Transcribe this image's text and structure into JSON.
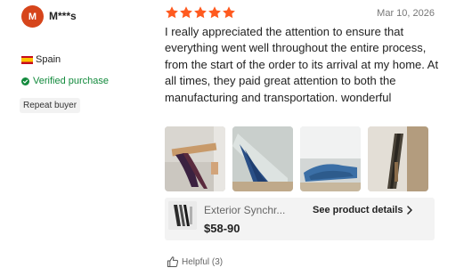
{
  "reviewer": {
    "avatar_letter": "M",
    "name": "M***s",
    "country": "Spain",
    "flag_icon": "spain-flag-icon",
    "verified_label": "Verified purchase",
    "verified_color": "#128a3c",
    "badge": "Repeat buyer"
  },
  "review": {
    "rating": 5,
    "max_rating": 5,
    "star_color": "#ff5a1f",
    "date": "Mar 10, 2026",
    "text": "I really appreciated the attention to ensure that everything went well throughout the entire process, from the start of the order to its arrival at my home. At all times, they paid great attention to both the manufacturing and transportation. wonderful",
    "photo_count": 4
  },
  "product": {
    "title": "Exterior Synchr...",
    "price": "$58-90",
    "details_link": "See product details"
  },
  "helpful": {
    "label": "Helpful (3)",
    "icon": "thumbs-up-icon"
  },
  "colors": {
    "avatar_bg": "#d6451b",
    "card_bg": "#f3f3f3"
  }
}
